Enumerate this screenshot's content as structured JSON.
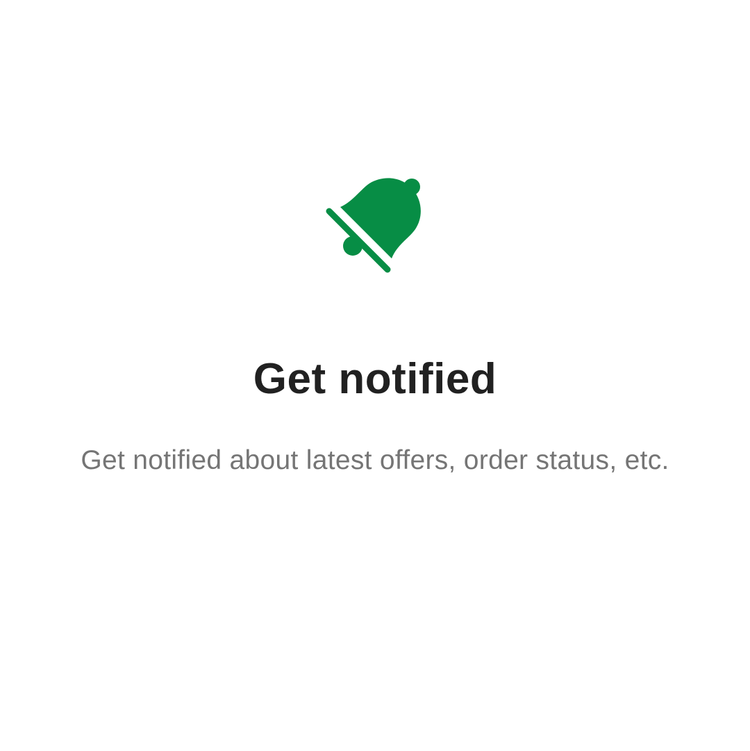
{
  "onboarding": {
    "icon": "bell-off-icon",
    "title": "Get notified",
    "description": "Get notified about latest offers, order status, etc."
  },
  "colors": {
    "accent": "#078D45",
    "title_text": "#212121",
    "description_text": "#757575",
    "background": "#FFFFFF"
  }
}
